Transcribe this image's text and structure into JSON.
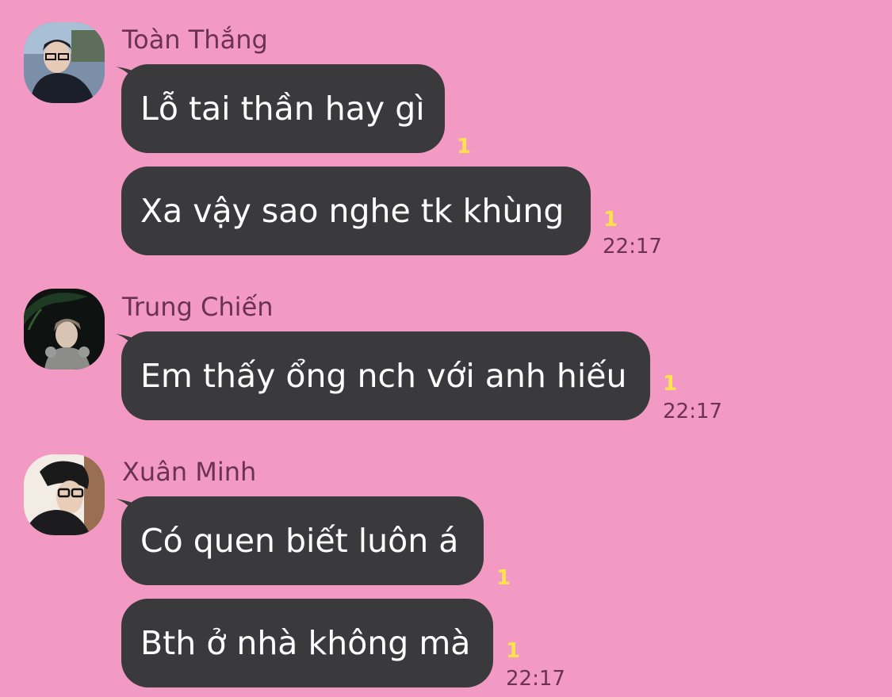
{
  "messages": [
    {
      "sender": "Toàn Thắng",
      "avatar_icon": "user-avatar-photo",
      "bubbles": [
        {
          "text": "Lỗ tai thần hay gì",
          "unread": "1",
          "time": ""
        },
        {
          "text": "Xa vậy sao nghe tk khùng",
          "unread": "1",
          "time": "22:17"
        }
      ]
    },
    {
      "sender": "Trung Chiến",
      "avatar_icon": "user-avatar-photo",
      "bubbles": [
        {
          "text": "Em thấy ổng nch với anh hiếu",
          "unread": "1",
          "time": "22:17"
        }
      ]
    },
    {
      "sender": "Xuân Minh",
      "avatar_icon": "user-avatar-photo",
      "bubbles": [
        {
          "text": "Có quen biết luôn á",
          "unread": "1",
          "time": ""
        },
        {
          "text": "Bth ở nhà không mà",
          "unread": "1",
          "time": "22:17"
        }
      ]
    }
  ],
  "colors": {
    "background": "#f29ac3",
    "bubble": "#3a3a3c",
    "bubble_text": "#ffffff",
    "sender_name": "#6b3350",
    "unread_count": "#ffe34d",
    "timestamp": "#6b3350"
  }
}
